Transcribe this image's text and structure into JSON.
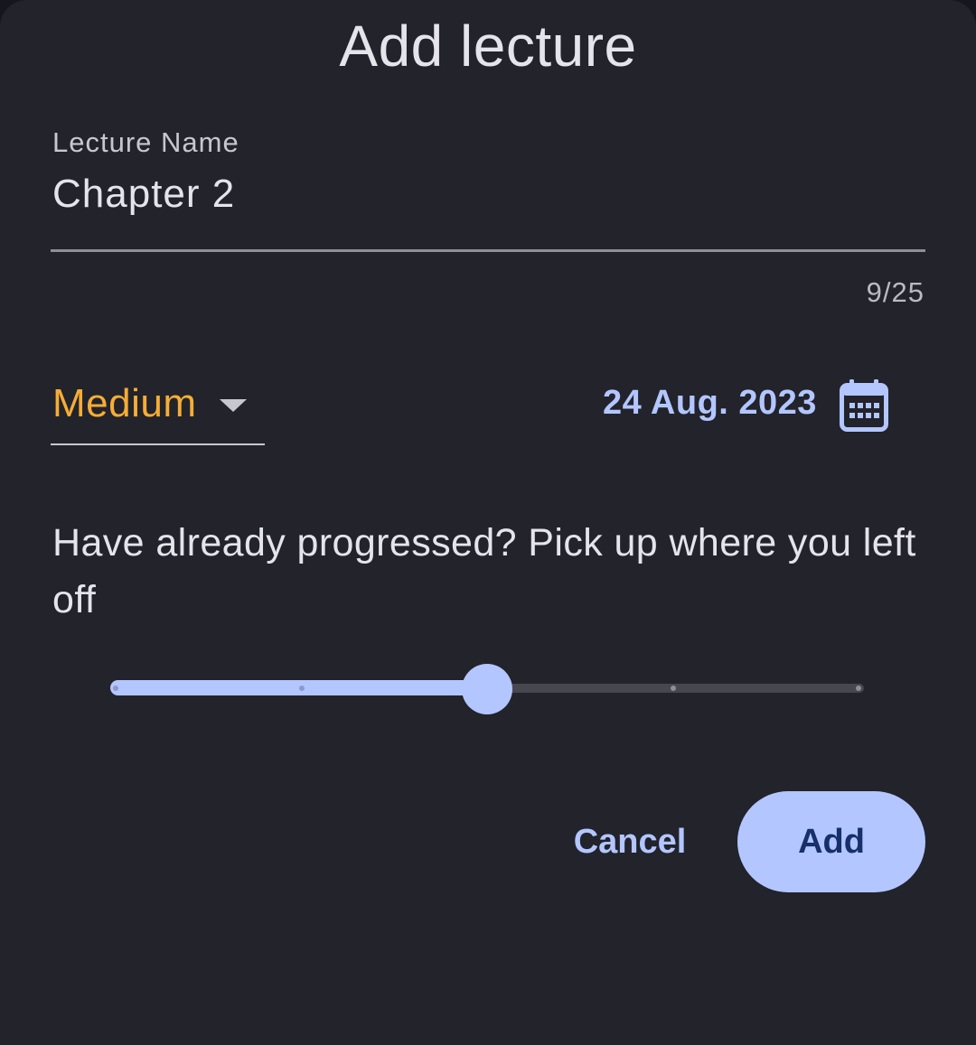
{
  "dialog": {
    "title": "Add lecture"
  },
  "lecture_name": {
    "label": "Lecture Name",
    "value": "Chapter 2",
    "counter": "9/25"
  },
  "priority": {
    "selected": "Medium",
    "icon": "dropdown-arrow-icon"
  },
  "date": {
    "value": "24 Aug. 2023",
    "icon": "calendar-icon"
  },
  "progress": {
    "prompt": "Have already progressed? Pick up where you left off",
    "steps": 4,
    "value_fraction": 0.5
  },
  "actions": {
    "cancel_label": "Cancel",
    "add_label": "Add"
  },
  "colors": {
    "accent": "#b3c6ff",
    "priority_medium": "#f5ad36",
    "surface": "#22232b",
    "on_accent": "#15306b"
  }
}
